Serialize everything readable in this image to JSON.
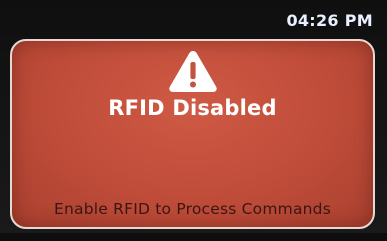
{
  "status_bar": {
    "time": "04:26 PM"
  },
  "alert": {
    "icon": "warning-icon",
    "title": "RFID Disabled",
    "message": "Enable RFID to Process Commands"
  },
  "colors": {
    "alert_background": "#bf4c39",
    "alert_border": "#e8d8d2",
    "message_text": "#3a1610",
    "clock_text": "#e9f0ff"
  }
}
